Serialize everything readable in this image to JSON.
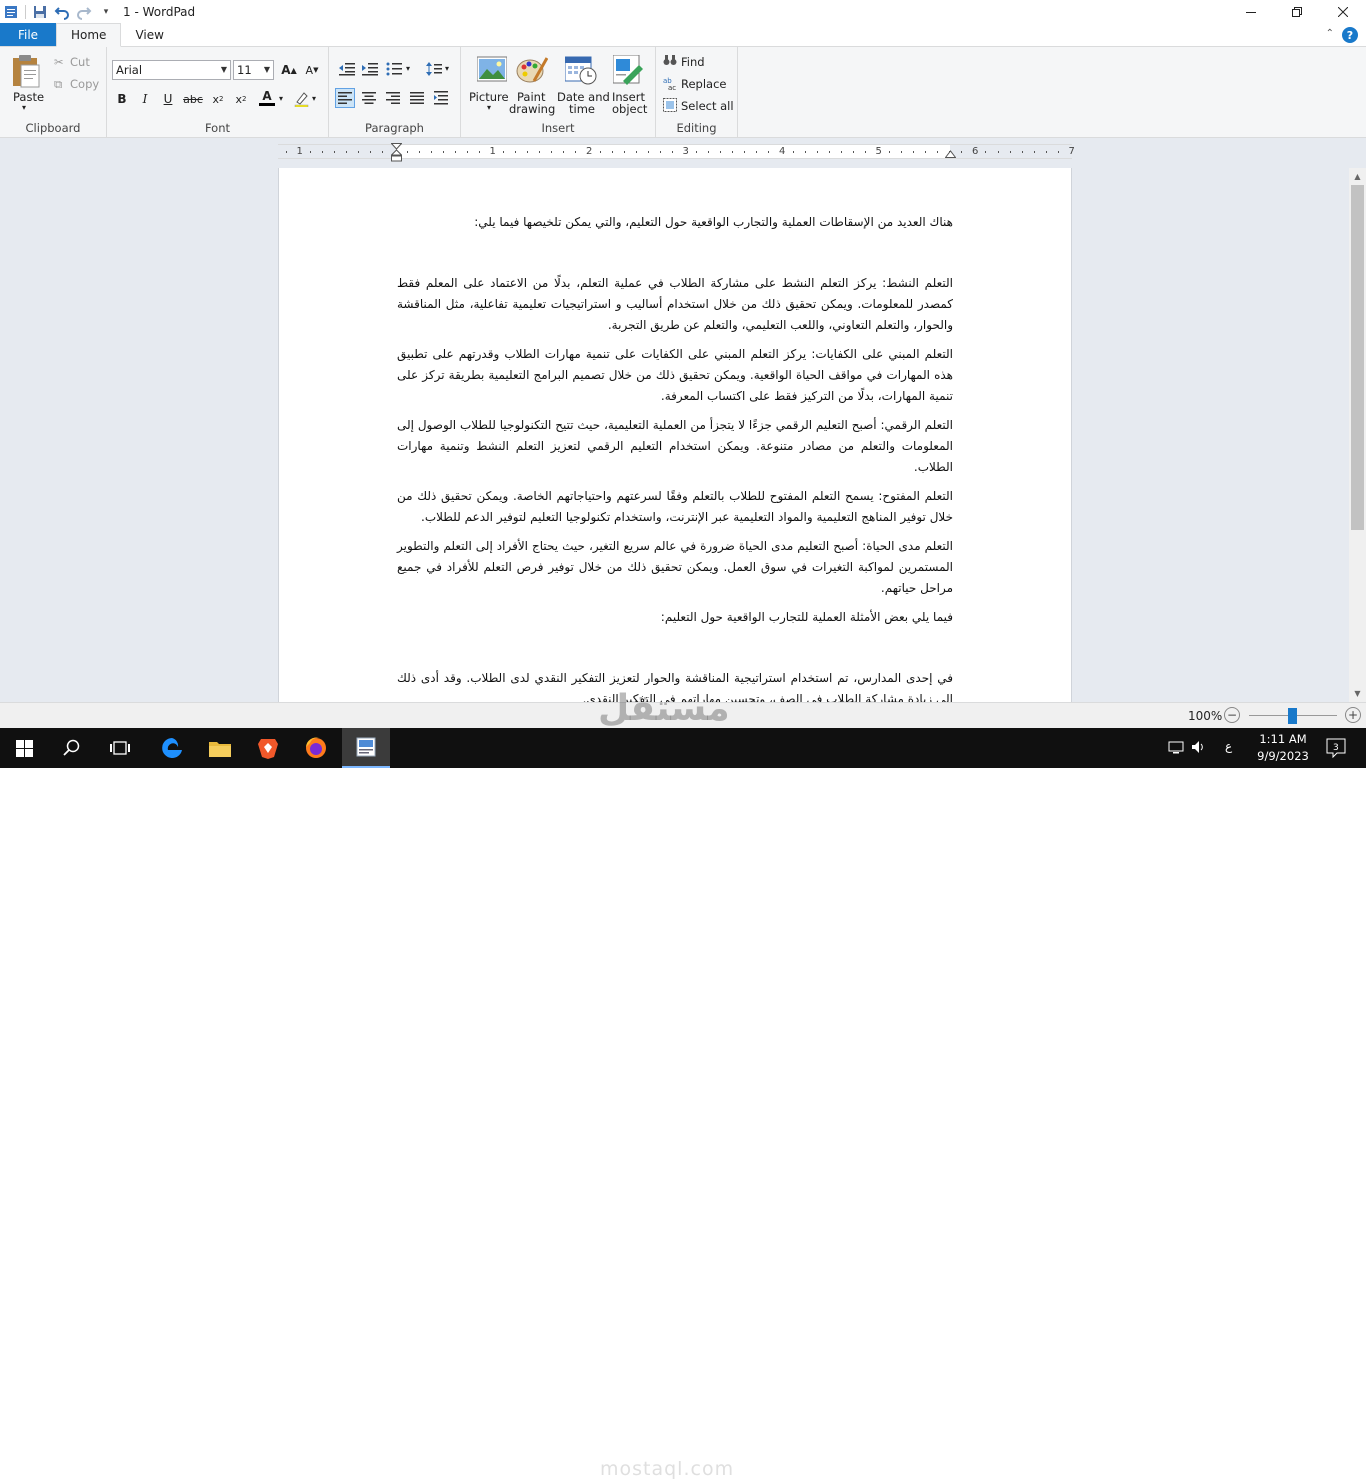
{
  "window": {
    "title": "1 - WordPad"
  },
  "tabs": {
    "file": "File",
    "home": "Home",
    "view": "View"
  },
  "ribbon": {
    "clipboard": {
      "label": "Clipboard",
      "paste": "Paste",
      "cut": "Cut",
      "copy": "Copy"
    },
    "font": {
      "label": "Font",
      "family": "Arial",
      "size": "11"
    },
    "paragraph": {
      "label": "Paragraph"
    },
    "insert": {
      "label": "Insert",
      "picture": "Picture",
      "paint1": "Paint",
      "paint2": "drawing",
      "date1": "Date and",
      "date2": "time",
      "object1": "Insert",
      "object2": "object"
    },
    "editing": {
      "label": "Editing",
      "find": "Find",
      "replace": "Replace",
      "select_all": "Select all"
    }
  },
  "ruler": {
    "numbers": [
      "1",
      "1",
      "2",
      "3",
      "4",
      "5",
      "6",
      "7"
    ]
  },
  "document": {
    "paragraphs": [
      "هناك العديد من الإسقاطات العملية والتجارب الواقعية حول التعليم، والتي يمكن تلخيصها فيما يلي:",
      "التعلم النشط: يركز التعلم النشط على مشاركة الطلاب في عملية التعلم، بدلًا من الاعتماد على المعلم فقط كمصدر للمعلومات. ويمكن تحقيق ذلك من خلال استخدام أساليب و استراتيجيات تعليمية تفاعلية، مثل المناقشة والحوار، والتعلم التعاوني، واللعب التعليمي، والتعلم عن طريق التجربة.",
      "التعلم المبني على الكفايات: يركز التعلم المبني على الكفايات على تنمية مهارات الطلاب وقدرتهم على تطبيق هذه المهارات في مواقف الحياة الواقعية. ويمكن تحقيق ذلك من خلال تصميم البرامج التعليمية بطريقة تركز على تنمية المهارات، بدلًا من التركيز فقط على اكتساب المعرفة.",
      "التعلم الرقمي: أصبح التعليم الرقمي جزءًا لا يتجزأ من العملية التعليمية، حيث تتيح التكنولوجيا للطلاب الوصول إلى المعلومات والتعلم من مصادر متنوعة. ويمكن استخدام التعليم الرقمي لتعزيز التعلم النشط وتنمية مهارات الطلاب.",
      "التعلم المفتوح: يسمح التعلم المفتوح للطلاب بالتعلم وفقًا لسرعتهم واحتياجاتهم الخاصة. ويمكن تحقيق ذلك من خلال توفير المناهج التعليمية والمواد التعليمية عبر الإنترنت، واستخدام تكنولوجيا التعليم لتوفير الدعم للطلاب.",
      "التعلم مدى الحياة: أصبح التعليم مدى الحياة ضرورة في عالم سريع التغير، حيث يحتاج الأفراد إلى التعلم والتطوير المستمرين لمواكبة التغيرات في سوق العمل. ويمكن تحقيق ذلك من خلال توفير فرص التعلم للأفراد في جميع مراحل حياتهم.",
      "فيما يلي بعض الأمثلة العملية للتجارب الواقعية حول التعليم:",
      "في إحدى المدارس، تم استخدام استراتيجية المناقشة والحوار لتعزيز التفكير النقدي لدى الطلاب. وقد أدى ذلك إلى زيادة مشاركة الطلاب في الصف، وتحسين مهاراتهم في التفكير النقدي."
    ]
  },
  "status": {
    "zoom": "100%"
  },
  "taskbar": {
    "time": "1:11 AM",
    "date": "9/9/2023",
    "lang": "ع",
    "notif_count": "3"
  },
  "watermark": {
    "arabic": "مستقل",
    "latin": "mostaql.com"
  }
}
